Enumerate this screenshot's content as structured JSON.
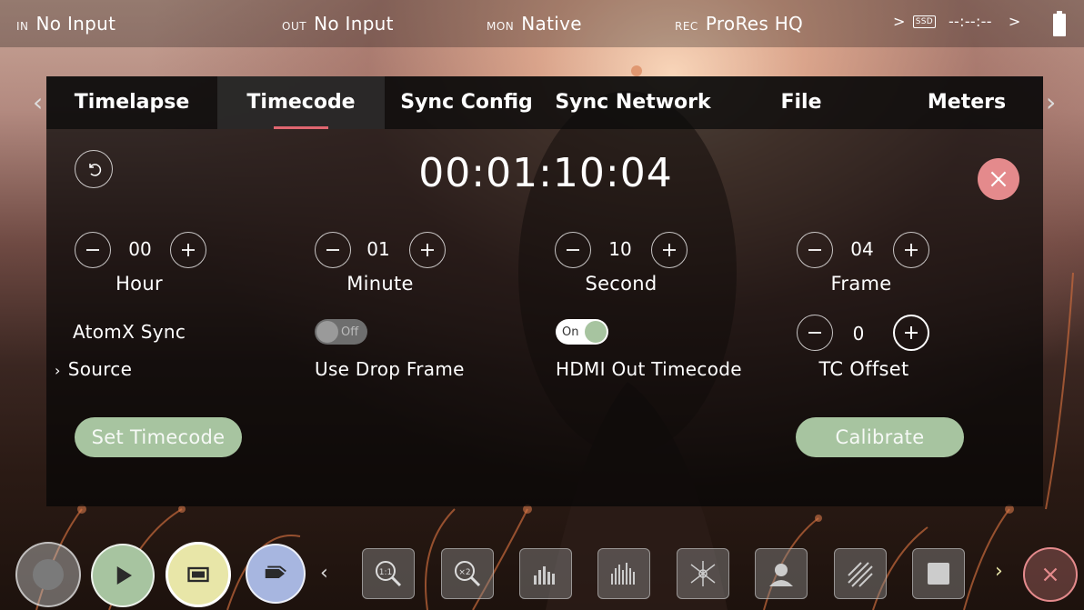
{
  "status_bar": {
    "in_tag": "IN",
    "in_value": "No Input",
    "out_tag": "OUT",
    "out_value": "No Input",
    "mon_tag": "MON",
    "mon_value": "Native",
    "rec_tag": "REC",
    "rec_value": "ProRes HQ",
    "media_label": "SSD",
    "time_remaining": "--:--:--"
  },
  "tabs": [
    {
      "label": "Timelapse",
      "active": false
    },
    {
      "label": "Timecode",
      "active": true
    },
    {
      "label": "Sync Config",
      "active": false
    },
    {
      "label": "Sync Network",
      "active": false
    },
    {
      "label": "File",
      "active": false
    },
    {
      "label": "Meters",
      "active": false
    }
  ],
  "timecode": {
    "display": "00:01:10:04",
    "hour": {
      "value": "00",
      "label": "Hour"
    },
    "minute": {
      "value": "01",
      "label": "Minute"
    },
    "second": {
      "value": "10",
      "label": "Second"
    },
    "frame": {
      "value": "04",
      "label": "Frame"
    }
  },
  "options": {
    "source_line1": "AtomX Sync",
    "source_line2": "Source",
    "drop_frame": {
      "label": "Use Drop Frame",
      "state_text": "Off",
      "on": false
    },
    "hdmi_out": {
      "label": "HDMI Out Timecode",
      "state_text": "On",
      "on": true
    },
    "tc_offset": {
      "label": "TC Offset",
      "value": "0"
    }
  },
  "buttons": {
    "set_timecode": "Set Timecode",
    "calibrate": "Calibrate"
  },
  "colors": {
    "accent_red": "#e06670",
    "close_pink": "#e48a8c",
    "green_button": "#a7c4a0",
    "toggle_on_knob": "#a7c4a0",
    "yellow_button": "#e8e6a8",
    "blue_button": "#a7b6e0"
  },
  "bottom_bar": {
    "icons": [
      "record-icon",
      "play-icon",
      "monitor-icon",
      "tag-icon",
      "zoom-1-1-icon",
      "zoom-x2-icon",
      "waveform-icon",
      "histogram-icon",
      "vectorscope-icon",
      "false-color-icon",
      "zebra-icon",
      "frame-guide-icon",
      "close-icon"
    ]
  }
}
